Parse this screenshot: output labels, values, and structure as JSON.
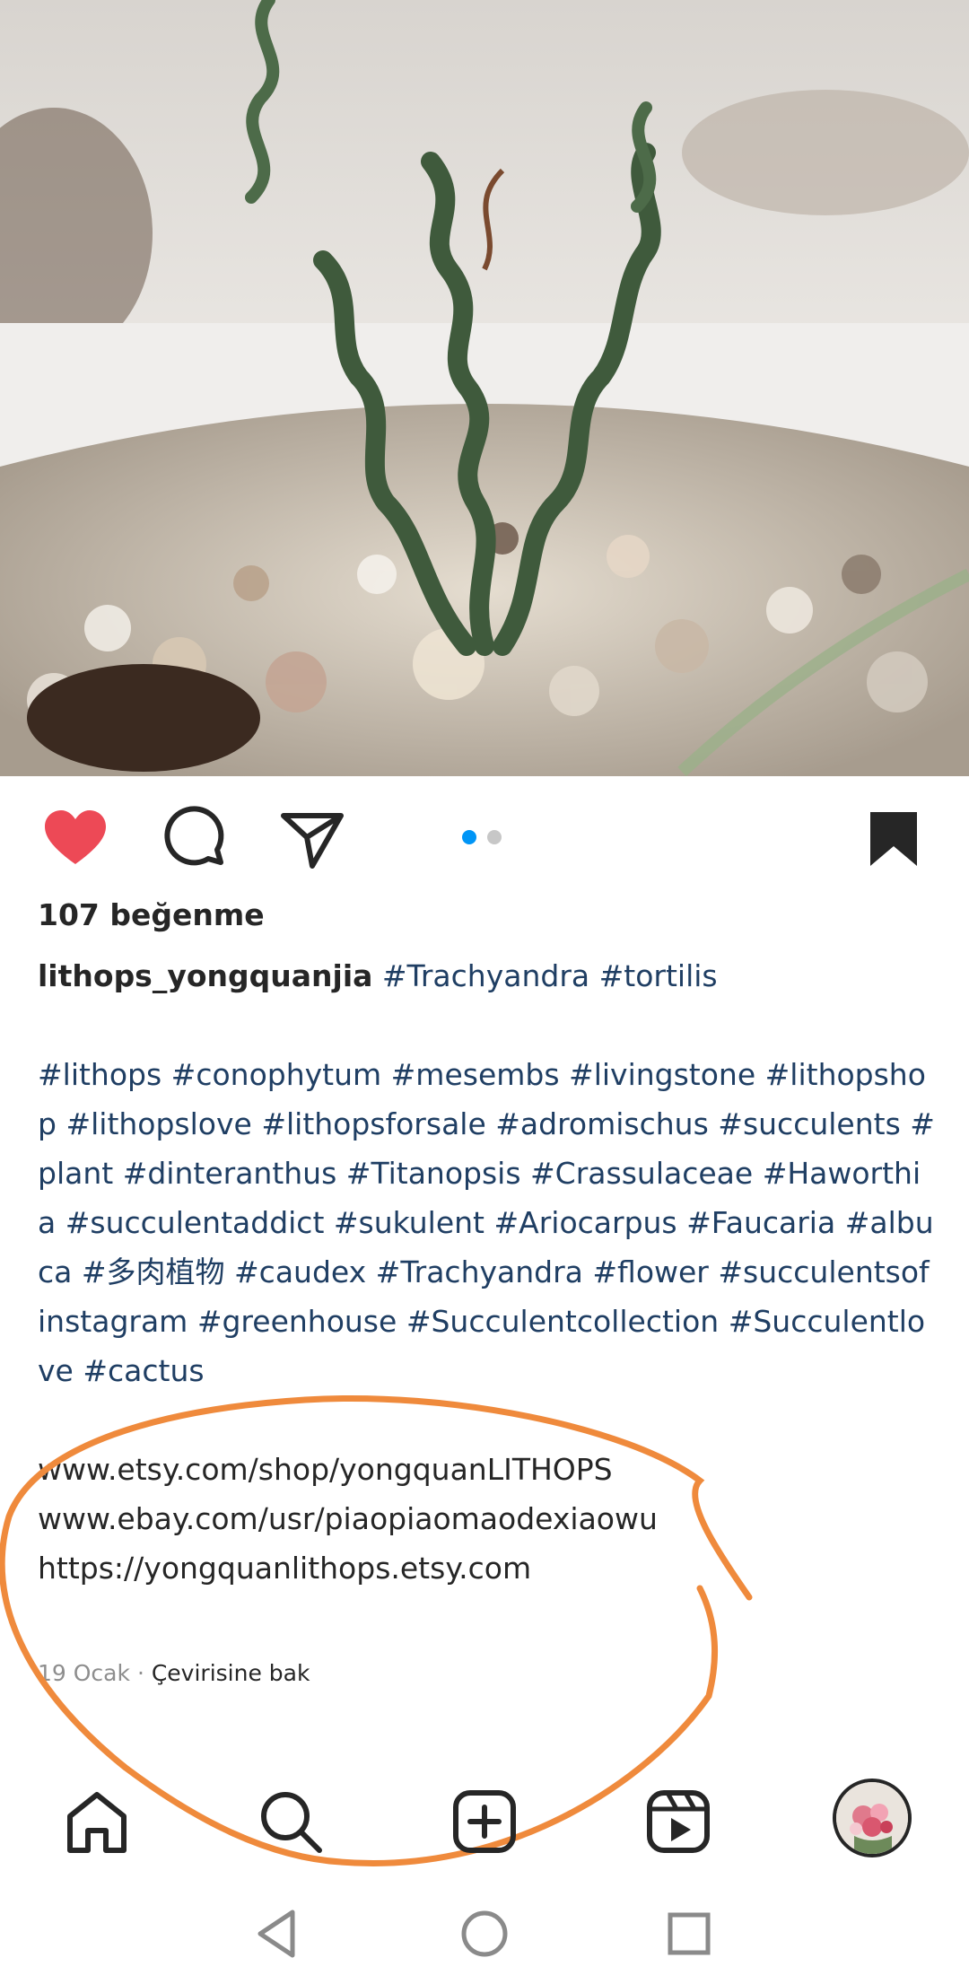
{
  "post": {
    "likes_text": "107 beğenme",
    "username": "lithops_yongquanjia",
    "caption_first_tags": [
      "#Trachyandra",
      "#tortilis"
    ],
    "hashtags": [
      "#lithops",
      "#conophytum",
      "#mesembs",
      "#livingstone",
      "#lithopshop",
      "#lithopslove",
      "#lithopsforsale",
      "#adromischus",
      "#succulents",
      "#plant",
      "#dinteranthus",
      "#Titanopsis",
      "#Crassulaceae",
      "#Haworthia",
      "#succulentaddict",
      "#sukulent",
      "#Ariocarpus",
      "#Faucaria",
      "#albuca",
      "#多肉植物",
      "#caudex",
      "#Trachyandra",
      "#flower",
      "#succulentsofinstagram",
      "#greenhouse",
      "#Succulentcollection",
      "#Succulentlove",
      "#cactus"
    ],
    "links": [
      "www.etsy.com/shop/yongquanLITHOPS",
      "www.ebay.com/usr/piaopiaomaodexiaowu",
      "https://yongquanlithops.etsy.com"
    ],
    "date": "19 Ocak",
    "separator": "·",
    "see_translation": "Çevirisine bak"
  },
  "carousel": {
    "count": 2,
    "active_index": 0
  },
  "actions": {
    "like_icon": "heart-filled-icon",
    "comment_icon": "comment-bubble-icon",
    "share_icon": "paper-plane-icon",
    "save_icon": "bookmark-filled-icon"
  },
  "tabbar": [
    "home-icon",
    "search-icon",
    "create-post-icon",
    "reels-icon",
    "profile-avatar"
  ],
  "navbar": [
    "back-triangle-icon",
    "home-circle-icon",
    "recents-square-icon"
  ],
  "colors": {
    "like": "#ed4956",
    "hashtag": "#1f3e63",
    "dot_active": "#0095f6",
    "dot_inactive": "#c7c7c7",
    "annotation": "#ef8a3c",
    "text": "#262626",
    "muted": "#8e8e8e"
  }
}
